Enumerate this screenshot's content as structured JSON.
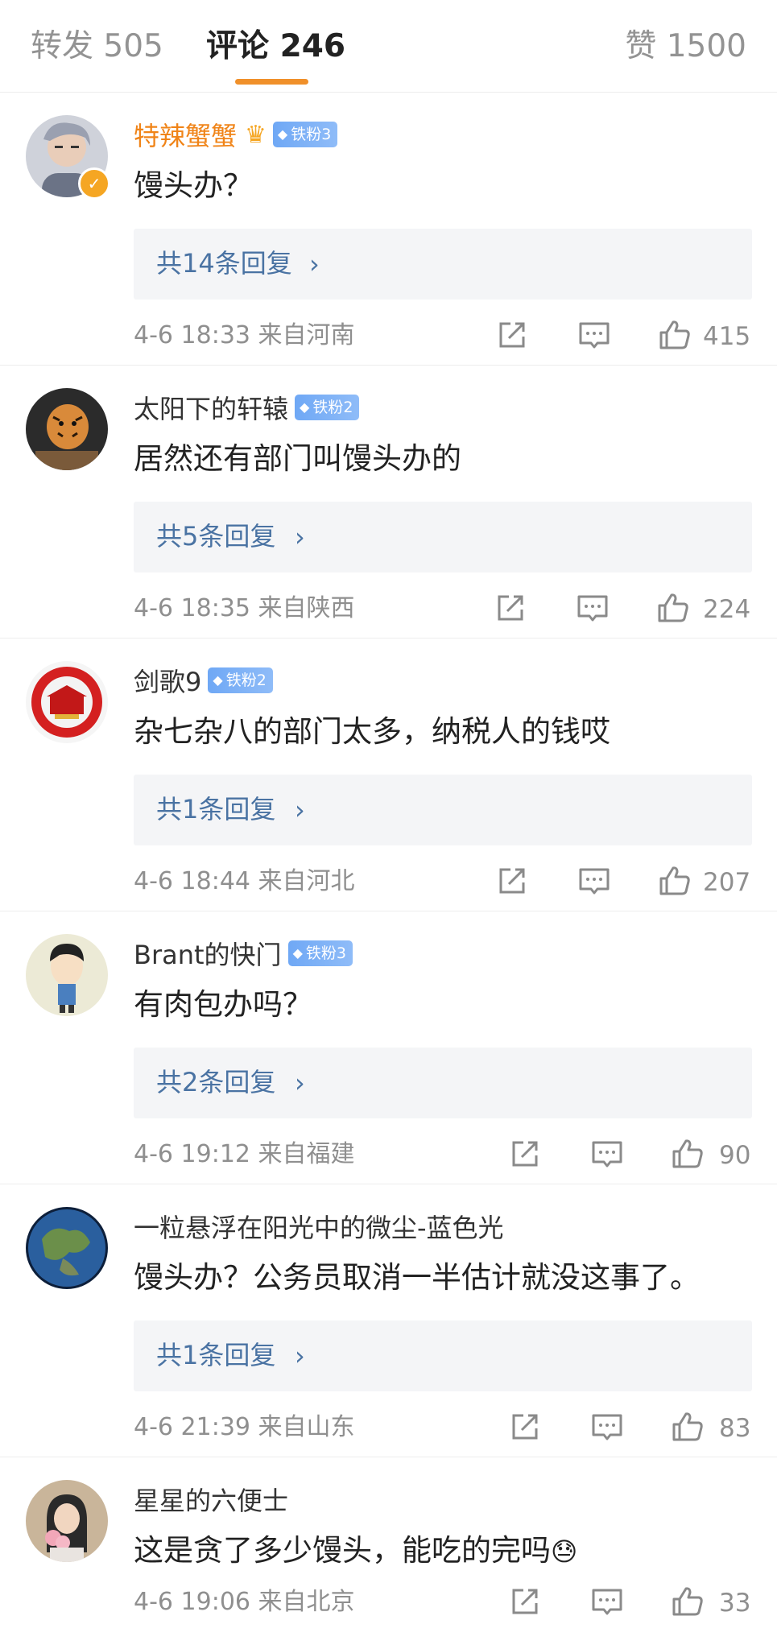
{
  "tabs": [
    {
      "label": "转发 505"
    },
    {
      "label": "评论 246"
    },
    {
      "label": "赞 1500"
    }
  ],
  "colors": {
    "accent": "#f0902a",
    "link": "#4a73a3",
    "vip_name": "#f08418"
  },
  "comments": [
    {
      "name": "特辣蟹蟹",
      "badge": "铁粉3",
      "text": "馒头办？",
      "reply": "共14条回复",
      "meta": "4-6 18:33 来自河南",
      "likes": "415",
      "avatar_icon": "user-avatar-photo",
      "vip": true,
      "verified": true
    },
    {
      "name": "太阳下的轩辕",
      "badge": "铁粉2",
      "text": "居然还有部门叫馒头办的",
      "reply": "共5条回复",
      "meta": "4-6 18:35 来自陕西",
      "likes": "224",
      "avatar_icon": "tiger-avatar"
    },
    {
      "name": "剑歌9",
      "badge": "铁粉2",
      "text": "杂七杂八的部门太多，纳税人的钱哎",
      "reply": "共1条回复",
      "meta": "4-6 18:44 来自河北",
      "likes": "207",
      "avatar_icon": "red-emblem-avatar"
    },
    {
      "name": "Brant的快门",
      "badge": "铁粉3",
      "text": "有肉包办吗？",
      "reply": "共2条回复",
      "meta": "4-6 19:12 来自福建",
      "likes": "90",
      "avatar_icon": "cartoon-boy-avatar"
    },
    {
      "name": "一粒悬浮在阳光中的微尘-蓝色光",
      "text": "馒头办？公务员取消一半估计就没这事了。",
      "reply": "共1条回复",
      "meta": "4-6 21:39 来自山东",
      "likes": "83",
      "avatar_icon": "earth-avatar"
    },
    {
      "name": "星星的六便士",
      "text": "这是贪了多少馒头，能吃的完吗",
      "emoji": "😓",
      "meta": "4-6 19:06 来自北京",
      "likes": "33",
      "avatar_icon": "girl-photo-avatar"
    }
  ]
}
